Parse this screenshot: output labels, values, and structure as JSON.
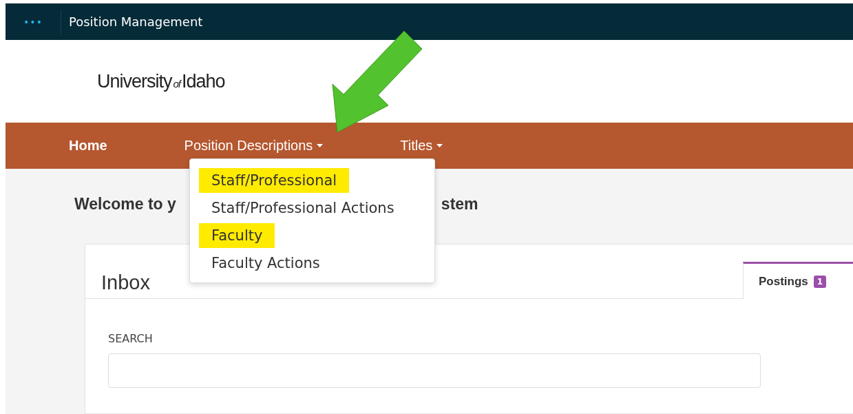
{
  "top_bar": {
    "menu_glyph": "•••",
    "title": "Position Management"
  },
  "logo": {
    "main": "University",
    "small": "of",
    "tail": "Idaho"
  },
  "nav": {
    "items": [
      {
        "label": "Home",
        "selected": true,
        "dropdown": false
      },
      {
        "label": "Position Descriptions",
        "selected": false,
        "dropdown": true
      },
      {
        "label": "Titles",
        "selected": false,
        "dropdown": true
      }
    ]
  },
  "dropdown_menu": {
    "items": [
      {
        "label": "Staff/Professional",
        "highlighted": true
      },
      {
        "label": "Staff/Professional Actions",
        "highlighted": false
      },
      {
        "label": "Faculty",
        "highlighted": true
      },
      {
        "label": "Faculty Actions",
        "highlighted": false
      }
    ]
  },
  "welcome": {
    "visible_start": "Welcome to y",
    "visible_end": "stem"
  },
  "inbox": {
    "title": "Inbox",
    "tabs": [
      {
        "label": "Postings",
        "count": "1",
        "selected": true
      }
    ],
    "search": {
      "label": "SEARCH"
    }
  }
}
